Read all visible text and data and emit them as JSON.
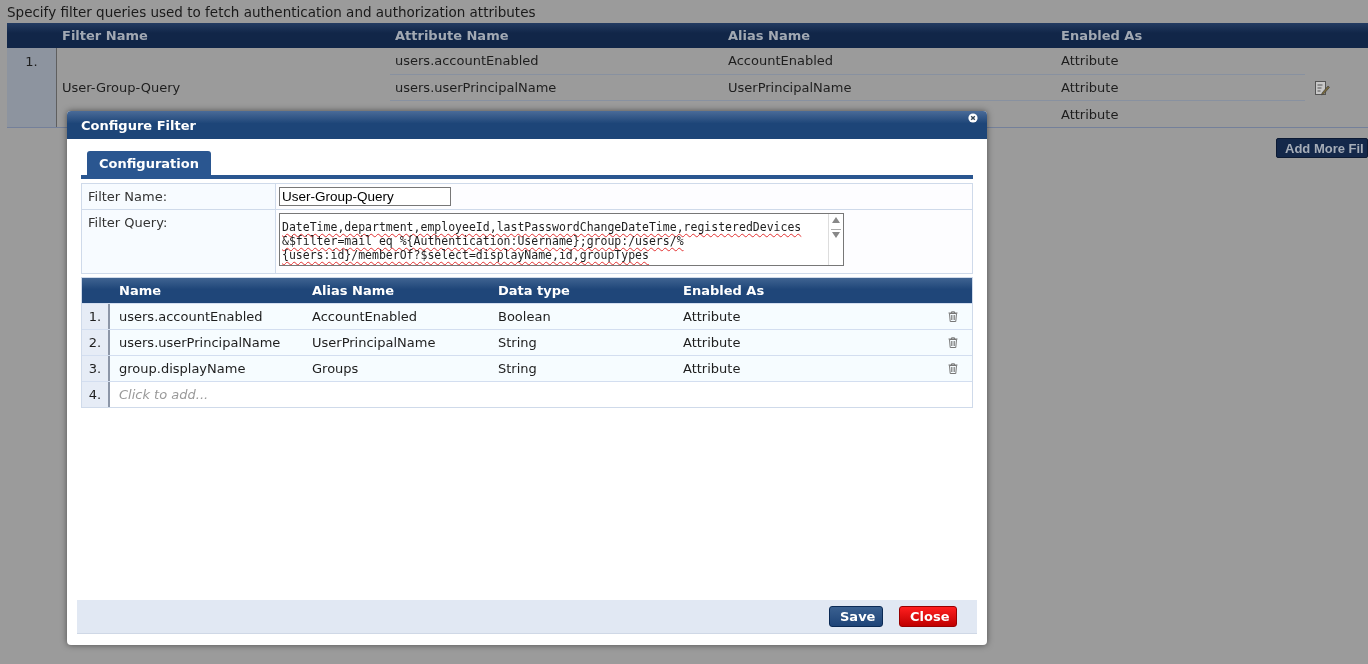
{
  "page": {
    "description": "Specify filter queries used to fetch authentication and authorization attributes",
    "filters_table": {
      "columns": [
        "Filter Name",
        "Attribute Name",
        "Alias Name",
        "Enabled As"
      ],
      "rows": [
        {
          "number": "1.",
          "filter_name": "User-Group-Query",
          "attributes": [
            {
              "attribute_name": "users.accountEnabled",
              "alias_name": "AccountEnabled",
              "enabled_as": "Attribute"
            },
            {
              "attribute_name": "users.userPrincipalName",
              "alias_name": "UserPrincipalName",
              "enabled_as": "Attribute"
            },
            {
              "enabled_as": "Attribute"
            }
          ]
        }
      ]
    },
    "add_button": "Add More Fil"
  },
  "dialog": {
    "title": "Configure Filter",
    "tabs": [
      {
        "label": "Configuration",
        "selected": true
      }
    ],
    "form": {
      "filter_name_label": "Filter Name:",
      "filter_name_value": "User-Group-Query",
      "filter_query_label": "Filter Query:",
      "filter_query_lines": [
        "DateTime,department,employeeId,lastPasswordChangeDateTime,registeredDevices",
        "&$filter=mail eq %{Authentication:Username};group:/users/%",
        "{users:id}/memberOf?$select=displayName,id,groupTypes"
      ]
    },
    "attributes_table": {
      "columns": [
        "Name",
        "Alias Name",
        "Data type",
        "Enabled As"
      ],
      "rows": [
        {
          "number": "1.",
          "name": "users.accountEnabled",
          "alias_name": "AccountEnabled",
          "data_type": "Boolean",
          "enabled_as": "Attribute"
        },
        {
          "number": "2.",
          "name": "users.userPrincipalName",
          "alias_name": "UserPrincipalName",
          "data_type": "String",
          "enabled_as": "Attribute"
        },
        {
          "number": "3.",
          "name": "group.displayName",
          "alias_name": "Groups",
          "data_type": "String",
          "enabled_as": "Attribute"
        }
      ],
      "add_row": {
        "number": "4.",
        "placeholder": "Click to add..."
      }
    },
    "buttons": [
      {
        "label": "Save",
        "kind": "primary"
      },
      {
        "label": "Close",
        "kind": "danger"
      }
    ]
  }
}
